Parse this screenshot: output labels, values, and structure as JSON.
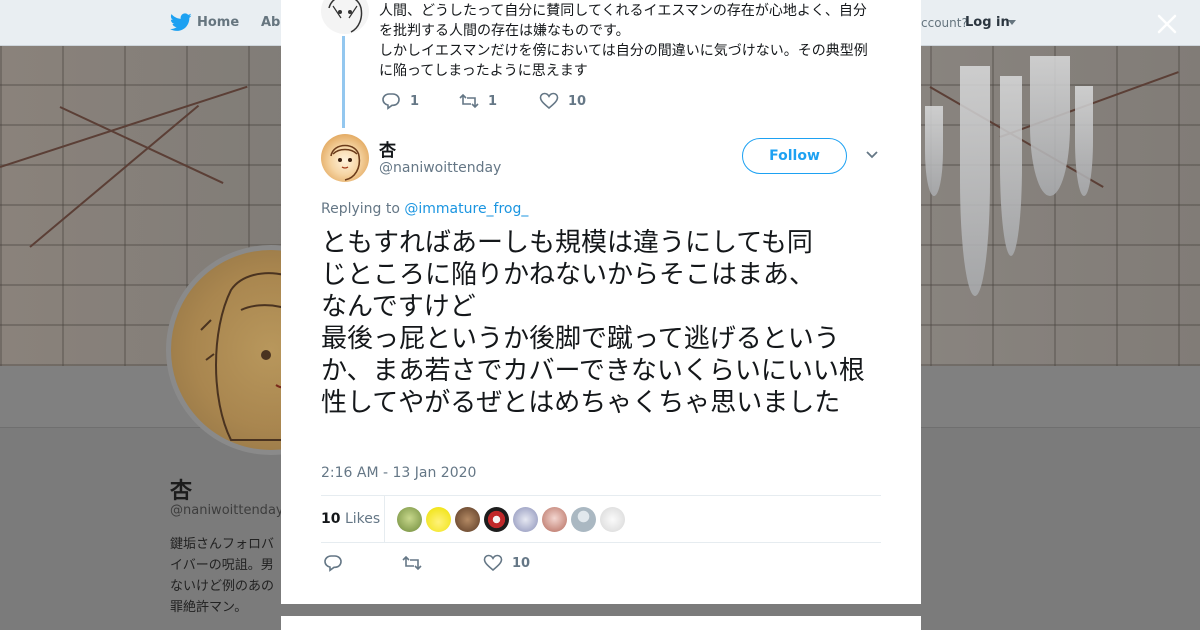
{
  "nav": {
    "home_label": "Home",
    "about_label": "Abo",
    "account_text": "ccount?",
    "login_label": "Log in"
  },
  "profile": {
    "name": "杏",
    "handle": "@naniwoittenday",
    "bio_lines": [
      "鍵垢さんフォロバ",
      "イバーの呪詛。男",
      "ないけど例のあの",
      "罪絶許マン。"
    ]
  },
  "previous_tweet": {
    "text_lines": [
      "人間、どうしたって自分に賛同してくれるイエスマンの存在が心地よく、自分",
      "を批判する人間の存在は嫌なものです。",
      "しかしイエスマンだけを傍においては自分の間違いに気づけない。その典型例",
      "に陥ってしまったように思えます"
    ],
    "replies": "1",
    "retweets": "1",
    "likes": "10"
  },
  "tweet": {
    "author_name": "杏",
    "author_handle": "@naniwoittenday",
    "follow_label": "Follow",
    "replying_prefix": "Replying to",
    "replying_to": "@immature_frog_",
    "text_lines": [
      "ともすればあーしも規模は違うにしても同",
      "じところに陥りかねないからそこはまあ、",
      "なんですけど",
      "最後っ屁というか後脚で蹴って逃げるというか、まあ若さでカバーできないくらいにいい根性してやがるぜとはめちゃくちゃ思いました"
    ],
    "timestamp": "2:16 AM - 13 Jan 2020",
    "likes_count": "10",
    "likes_label": "Likes",
    "action_likes": "10"
  },
  "colors": {
    "accent": "#1da1f2",
    "thread_line": "#93c7ef",
    "muted": "#657786",
    "text": "#14171a"
  },
  "icons": [
    "twitter-bird-icon",
    "close-icon",
    "reply-icon",
    "retweet-icon",
    "heart-icon",
    "chevron-down-icon"
  ]
}
